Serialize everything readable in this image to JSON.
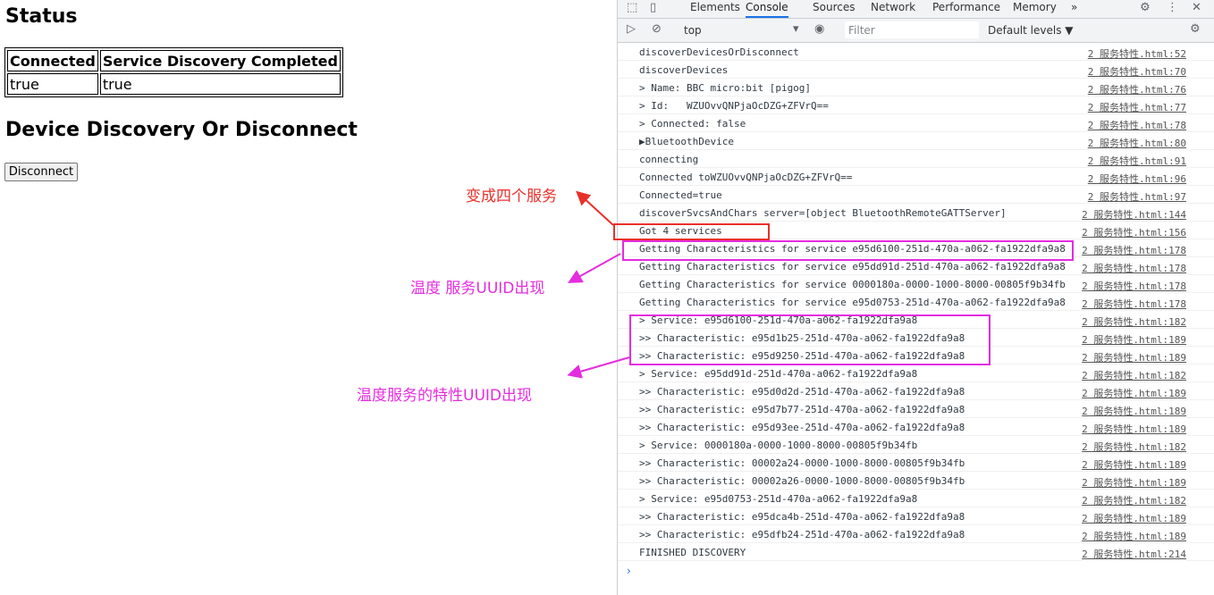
{
  "page": {
    "status_heading": "Status",
    "table": {
      "headers": [
        "Connected",
        "Service Discovery Completed"
      ],
      "values": [
        "true",
        "true"
      ]
    },
    "device_heading": "Device Discovery Or Disconnect",
    "disconnect_label": "Disconnect"
  },
  "annotations": {
    "four_services": "变成四个服务",
    "temp_service_uuid": "温度 服务UUID出现",
    "temp_char_uuid": "温度服务的特性UUID出现",
    "red_color": "#e8302a",
    "magenta_color": "#e52ce0"
  },
  "devtools": {
    "tabs": [
      "Elements",
      "Console",
      "Sources",
      "Network",
      "Performance",
      "Memory"
    ],
    "active_tab": "Console",
    "more_tabs_icon": "»",
    "context": "top",
    "filter_placeholder": "Filter",
    "levels": "Default levels ▼",
    "log": [
      {
        "msg": "discoverDevicesOrDisconnect",
        "src": "2 服务特性.html:52"
      },
      {
        "msg": "discoverDevices",
        "src": "2 服务特性.html:70"
      },
      {
        "msg": "> Name: BBC micro:bit [pigog]",
        "src": "2 服务特性.html:76"
      },
      {
        "msg": "> Id:   WZUOvvQNPjaOcDZG+ZFVrQ==",
        "src": "2 服务特性.html:77"
      },
      {
        "msg": "> Connected: false",
        "src": "2 服务特性.html:78"
      },
      {
        "msg": "▶BluetoothDevice",
        "src": "2 服务特性.html:80"
      },
      {
        "msg": "connecting",
        "src": "2 服务特性.html:91"
      },
      {
        "msg": "Connected toWZUOvvQNPjaOcDZG+ZFVrQ==",
        "src": "2 服务特性.html:96"
      },
      {
        "msg": "Connected=true",
        "src": "2 服务特性.html:97"
      },
      {
        "msg": "discoverSvcsAndChars server=[object BluetoothRemoteGATTServer]",
        "src": "2 服务特性.html:144"
      },
      {
        "msg": "Got 4 services",
        "src": "2 服务特性.html:156"
      },
      {
        "msg": "Getting Characteristics for service e95d6100-251d-470a-a062-fa1922dfa9a8",
        "src": "2 服务特性.html:178"
      },
      {
        "msg": "Getting Characteristics for service e95dd91d-251d-470a-a062-fa1922dfa9a8",
        "src": "2 服务特性.html:178"
      },
      {
        "msg": "Getting Characteristics for service 0000180a-0000-1000-8000-00805f9b34fb",
        "src": "2 服务特性.html:178"
      },
      {
        "msg": "Getting Characteristics for service e95d0753-251d-470a-a062-fa1922dfa9a8",
        "src": "2 服务特性.html:178"
      },
      {
        "msg": "> Service: e95d6100-251d-470a-a062-fa1922dfa9a8",
        "src": "2 服务特性.html:182"
      },
      {
        "msg": ">> Characteristic: e95d1b25-251d-470a-a062-fa1922dfa9a8",
        "src": "2 服务特性.html:189"
      },
      {
        "msg": ">> Characteristic: e95d9250-251d-470a-a062-fa1922dfa9a8",
        "src": "2 服务特性.html:189"
      },
      {
        "msg": "> Service: e95dd91d-251d-470a-a062-fa1922dfa9a8",
        "src": "2 服务特性.html:182"
      },
      {
        "msg": ">> Characteristic: e95d0d2d-251d-470a-a062-fa1922dfa9a8",
        "src": "2 服务特性.html:189"
      },
      {
        "msg": ">> Characteristic: e95d7b77-251d-470a-a062-fa1922dfa9a8",
        "src": "2 服务特性.html:189"
      },
      {
        "msg": ">> Characteristic: e95d93ee-251d-470a-a062-fa1922dfa9a8",
        "src": "2 服务特性.html:189"
      },
      {
        "msg": "> Service: 0000180a-0000-1000-8000-00805f9b34fb",
        "src": "2 服务特性.html:182"
      },
      {
        "msg": ">> Characteristic: 00002a24-0000-1000-8000-00805f9b34fb",
        "src": "2 服务特性.html:189"
      },
      {
        "msg": ">> Characteristic: 00002a26-0000-1000-8000-00805f9b34fb",
        "src": "2 服务特性.html:189"
      },
      {
        "msg": "> Service: e95d0753-251d-470a-a062-fa1922dfa9a8",
        "src": "2 服务特性.html:182"
      },
      {
        "msg": ">> Characteristic: e95dca4b-251d-470a-a062-fa1922dfa9a8",
        "src": "2 服务特性.html:189"
      },
      {
        "msg": ">> Characteristic: e95dfb24-251d-470a-a062-fa1922dfa9a8",
        "src": "2 服务特性.html:189"
      },
      {
        "msg": "FINISHED DISCOVERY",
        "src": "2 服务特性.html:214"
      }
    ],
    "prompt": "›"
  }
}
